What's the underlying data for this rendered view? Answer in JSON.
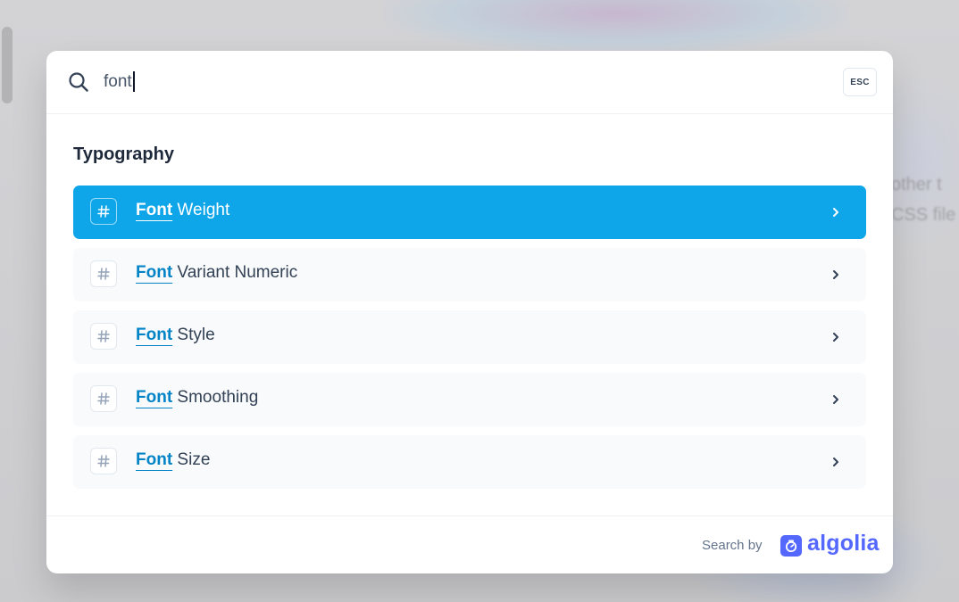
{
  "background": {
    "peek_text_1": "other t",
    "peek_text_2": "CSS file"
  },
  "search": {
    "query": "font",
    "esc_label": "ESC"
  },
  "results": {
    "section_title": "Typography",
    "hits": [
      {
        "match": "Font",
        "rest": " Weight",
        "active": true
      },
      {
        "match": "Font",
        "rest": " Variant Numeric",
        "active": false
      },
      {
        "match": "Font",
        "rest": " Style",
        "active": false
      },
      {
        "match": "Font",
        "rest": " Smoothing",
        "active": false
      },
      {
        "match": "Font",
        "rest": " Size",
        "active": false
      }
    ]
  },
  "footer": {
    "search_by_label": "Search by",
    "brand_name": "algolia"
  },
  "colors": {
    "accent": "#0ea5e9",
    "match_text": "#0284c7",
    "algolia_brand": "#5468ff"
  },
  "icons": {
    "search": "search-icon",
    "hash": "hash-icon",
    "chevron": "chevron-right-icon",
    "algolia": "algolia-logo-icon"
  }
}
